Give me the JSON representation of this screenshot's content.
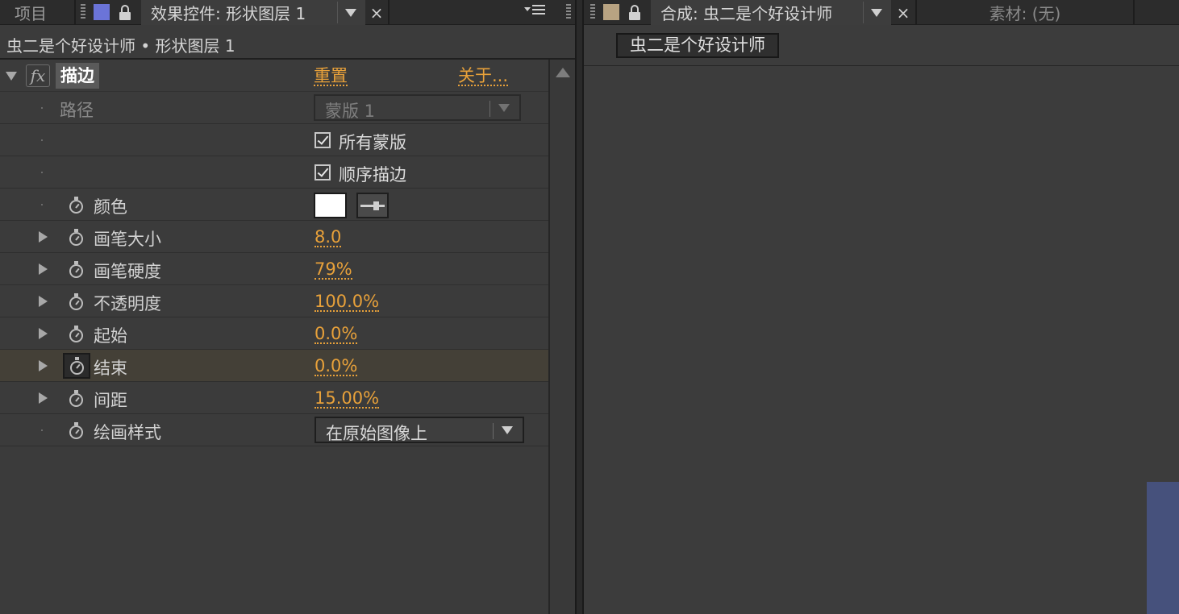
{
  "tabs": {
    "project": "项目",
    "effect_controls": "效果控件: 形状图层 1",
    "composition": "合成: 虫二是个好设计师",
    "footage": "素材: (无)",
    "close_symbol": "×"
  },
  "colors": {
    "effect_label_chip": "#6b74d8",
    "comp_label_chip": "#b8a382",
    "value_accent": "#e8a13a",
    "viewer_layer": "#46517c"
  },
  "effect_panel": {
    "layer_title": "虫二是个好设计师 • 形状图层 1",
    "fx_icon": "fx",
    "effect_name": "描边",
    "reset_label": "重置",
    "about_label": "关于...",
    "path": {
      "label": "路径",
      "value": "蒙版 1"
    },
    "all_masks": {
      "label": "所有蒙版",
      "checked": true
    },
    "stroke_sequentially": {
      "label": "顺序描边",
      "checked": true
    },
    "color": {
      "label": "颜色",
      "value": "#ffffff",
      "eyedropper_icon": "eyedropper-icon"
    },
    "brush_size": {
      "label": "画笔大小",
      "value": "8.0"
    },
    "brush_hardness": {
      "label": "画笔硬度",
      "value": "79%"
    },
    "opacity": {
      "label": "不透明度",
      "value": "100.0%"
    },
    "start": {
      "label": "起始",
      "value": "0.0%"
    },
    "end": {
      "label": "结束",
      "value": "0.0%"
    },
    "spacing": {
      "label": "间距",
      "value": "15.00%"
    },
    "paint_style": {
      "label": "绘画样式",
      "value": "在原始图像上"
    }
  },
  "comp_panel": {
    "comp_name_button": "虫二是个好设计师"
  }
}
